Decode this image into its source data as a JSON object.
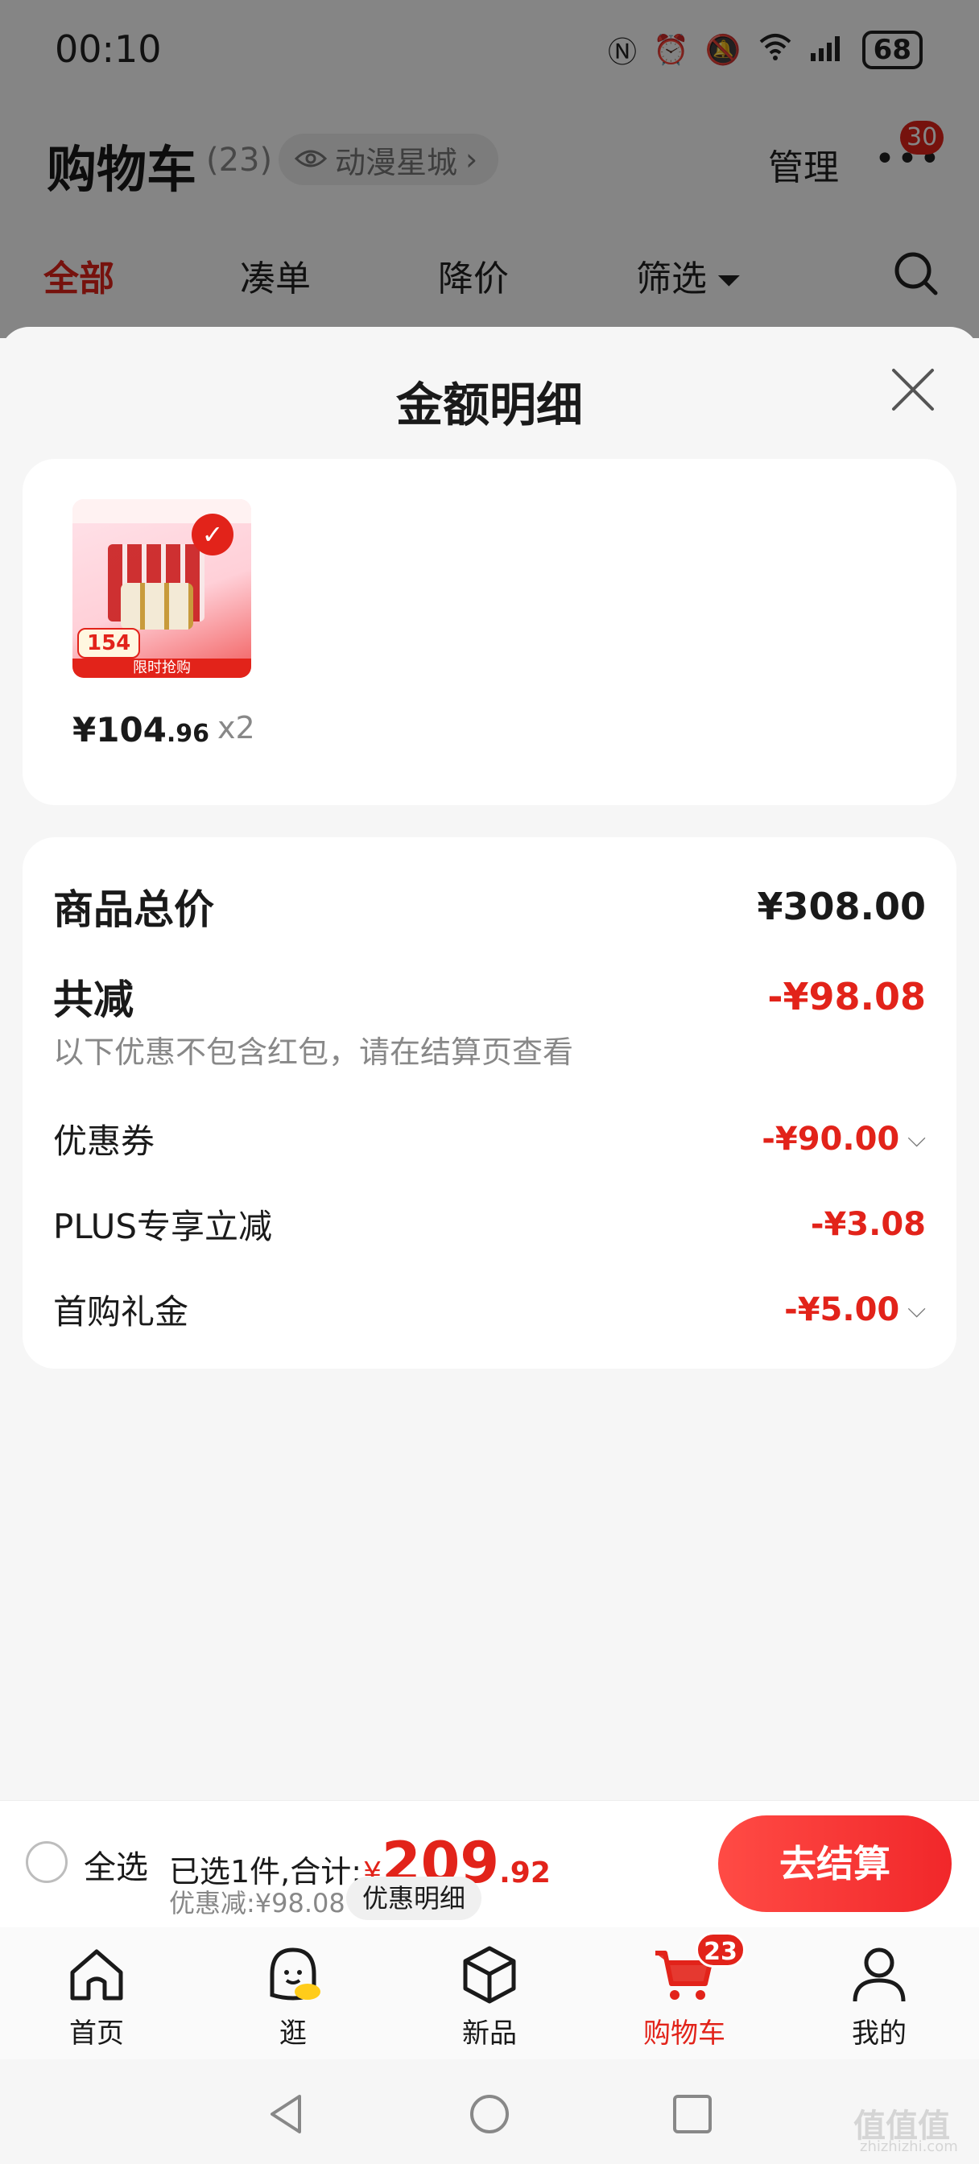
{
  "status_bar": {
    "time": "00:10",
    "battery": "68"
  },
  "header": {
    "title": "购物车",
    "count": "(23)",
    "store_name": "动漫星城",
    "manage_label": "管理",
    "message_badge": "30"
  },
  "tabs": [
    "全部",
    "凑单",
    "降价",
    "筛选"
  ],
  "sheet": {
    "title": "金额明细",
    "product": {
      "price_main": "¥104",
      "price_cents": ".96",
      "quantity": "x2",
      "thumb_price_tag": "154",
      "thumb_strip": "限时抢购"
    },
    "rows": {
      "total_label": "商品总价",
      "total_value": "¥308.00",
      "reduced_label": "共减",
      "reduced_value": "-¥98.08",
      "note": "以下优惠不包含红包，请在结算页查看",
      "coupon_label": "优惠券",
      "coupon_value": "-¥90.00",
      "plus_label": "PLUS专享立减",
      "plus_value": "-¥3.08",
      "firstbuy_label": "首购礼金",
      "firstbuy_value": "-¥5.00"
    }
  },
  "checkout": {
    "select_all": "全选",
    "selected_text": "已选1件,合计:",
    "total_symbol": "¥",
    "total_int": "209",
    "total_dec": ".92",
    "discount": "优惠减:¥98.08",
    "detail_pill": "优惠明细",
    "checkout_button": "去结算"
  },
  "bottom_nav": {
    "items": [
      "首页",
      "逛",
      "新品",
      "购物车",
      "我的"
    ],
    "cart_badge": "23"
  },
  "watermark": {
    "text": "值值值",
    "sub": "zhizhizhi.com"
  },
  "colors": {
    "accent_red": "#e2231a",
    "sheet_bg": "#f6f6f6"
  }
}
